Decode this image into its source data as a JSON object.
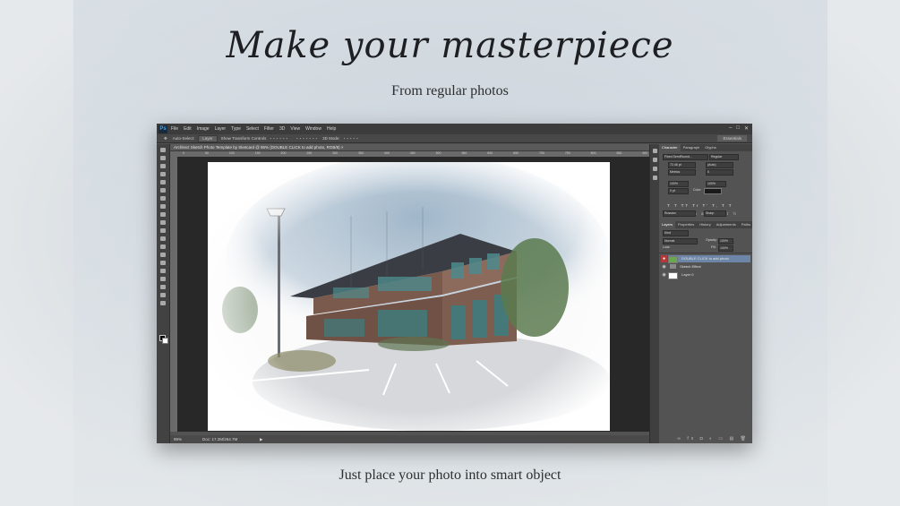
{
  "marketing": {
    "headline": "Make your masterpiece",
    "subheadline": "From regular photos",
    "caption": "Just place your photo into smart object"
  },
  "app": {
    "logo": "Ps",
    "menu": [
      "File",
      "Edit",
      "Image",
      "Layer",
      "Type",
      "Select",
      "Filter",
      "3D",
      "View",
      "Window",
      "Help"
    ],
    "window_buttons": [
      "–",
      "□",
      "✕"
    ],
    "options": {
      "auto_select_label": "Auto-Select:",
      "auto_select_value": "Layer",
      "transform_controls": "Show Transform Controls",
      "mode_3d": "3D Mode:",
      "workspace": "Essentials"
    },
    "doc_tab": "Architect Sketch Photo Template by Sketcard @ 95% (DOUBLE CLICK to add photo, RGB/8) ×",
    "ruler_ticks": [
      "0",
      "50",
      "100",
      "150",
      "200",
      "250",
      "300",
      "350",
      "400",
      "450",
      "500",
      "550",
      "600",
      "650",
      "700",
      "750",
      "800",
      "850",
      "900",
      "950",
      "1000"
    ],
    "status": {
      "zoom": "95%",
      "doc": "Doc: 17.2M/264.7M",
      "arrow": "▶"
    },
    "panels": {
      "char_tabs": [
        "Character",
        "Paragraph",
        "Glyphs"
      ],
      "font_family": "Fixed SemiRound...",
      "font_style": "Regular",
      "size": "72.46 pt",
      "leading": "(Auto)",
      "kerning": "Metrics",
      "tracking": "0",
      "scale_v": "100%",
      "scale_h": "100%",
      "baseline": "0 pt",
      "color_label": "Color:",
      "type_styles": "T T TT Tr T' T, T T",
      "opentype": "fi σ st A ad T 1st ½",
      "language": "Russian",
      "aa": "Sharp",
      "layer_tabs": [
        "Layers",
        "Properties",
        "History",
        "Adjustments",
        "Paths"
      ],
      "kind": "Kind",
      "blend_mode": "Normal",
      "opacity_label": "Opacity:",
      "opacity": "100%",
      "lock_label": "Lock:",
      "fill_label": "Fill:",
      "fill": "100%",
      "layers": [
        {
          "name": "DOUBLE CLICK to add photo",
          "selected": true
        },
        {
          "name": "Sketch Effect",
          "selected": false
        },
        {
          "name": "Layer 0",
          "selected": false
        }
      ],
      "footer_icons": "∞ fx ◘ ◐ ▭ ▤ 🗑"
    }
  },
  "colors": {
    "sky": "#9bb3c7",
    "brick": "#7a5a4c",
    "roof": "#3a3e44",
    "glass": "#4e8a8c",
    "tree": "#5b7a4f",
    "layer_selected": "#6d86a8"
  }
}
